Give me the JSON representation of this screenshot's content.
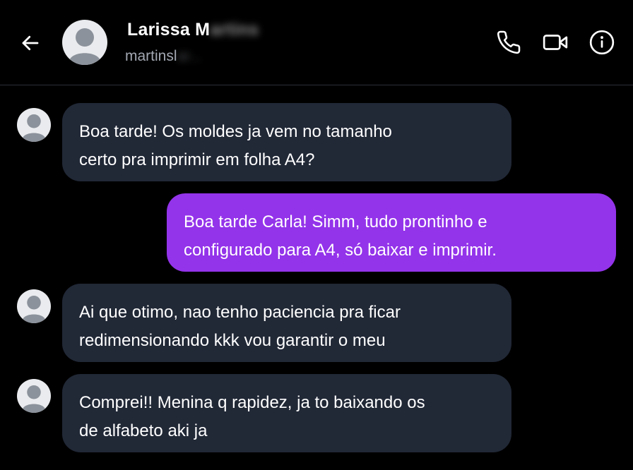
{
  "header": {
    "name_visible": "Larissa M",
    "name_blurred": "artins",
    "handle_visible": "martinsl",
    "handle_blurred": "ar..."
  },
  "icons": {
    "back": "arrow-left-icon",
    "call": "phone-icon",
    "video": "video-camera-icon",
    "info": "info-icon"
  },
  "colors": {
    "background": "#000000",
    "incoming_bubble": "#212836",
    "outgoing_bubble": "#9333ea"
  },
  "messages": [
    {
      "direction": "incoming",
      "lines": [
        "Boa tarde! Os moldes ja vem no tamanho",
        "certo pra imprimir em folha A4?"
      ]
    },
    {
      "direction": "outgoing",
      "lines": [
        "Boa tarde Carla! Simm, tudo prontinho e",
        "configurado para A4, só baixar e imprimir."
      ]
    },
    {
      "direction": "incoming",
      "lines": [
        "Ai que otimo, nao tenho paciencia pra ficar",
        "redimensionando kkk vou garantir o meu"
      ]
    },
    {
      "direction": "incoming",
      "lines": [
        "Comprei!! Menina q rapidez, ja to baixando os",
        "de alfabeto aki ja"
      ]
    }
  ]
}
